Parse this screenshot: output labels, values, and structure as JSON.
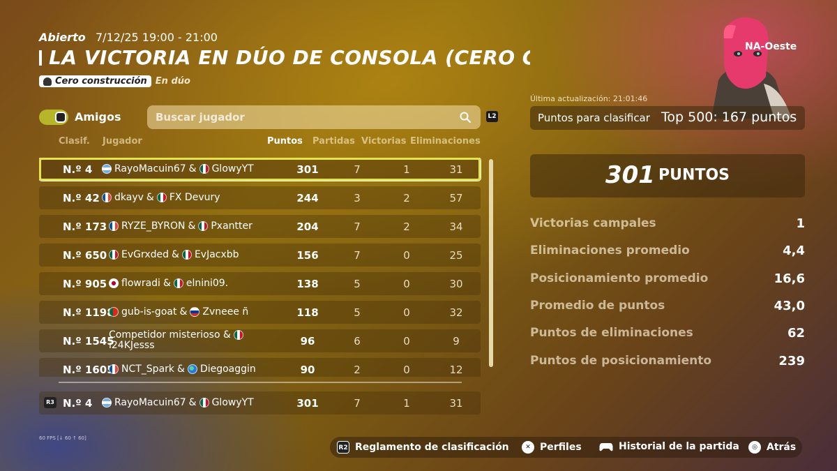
{
  "header": {
    "status": "Abierto",
    "datetime": "7/12/25 19:00 - 21:00",
    "title": "LA VICTORIA EN DÚO DE CONSOLA (CERO CONSTRUCCIÓN)",
    "mode_tag": "Cero construcción",
    "mode_sub": "En dúo"
  },
  "filters": {
    "friends_label": "Amigos",
    "friends_on": true,
    "search_placeholder": "Buscar jugador",
    "search_hotkey": "L2"
  },
  "columns": {
    "rank": "Clasif.",
    "player": "Jugador",
    "points": "Puntos",
    "matches": "Partidas",
    "wins": "Victorias",
    "elims": "Eliminaciones"
  },
  "rows": [
    {
      "rank": "N.º 4",
      "p1": "RayoMacuin67",
      "f1": "ar",
      "sep": "&",
      "p2": "GlowyYT",
      "f2": "mx",
      "points": "301",
      "matches": "7",
      "wins": "1",
      "elims": "31"
    },
    {
      "rank": "N.º 42",
      "p1": "dkayv",
      "f1": "fr",
      "sep": "&",
      "p2": "FX Devury",
      "f2": "mx",
      "points": "244",
      "matches": "3",
      "wins": "2",
      "elims": "57"
    },
    {
      "rank": "N.º 173",
      "p1": "RYZE_BYRON",
      "f1": "fr",
      "sep": "&",
      "p2": "Pxantter",
      "f2": "mx",
      "points": "204",
      "matches": "7",
      "wins": "2",
      "elims": "34"
    },
    {
      "rank": "N.º 650",
      "p1": "EvGrxded",
      "f1": "mx",
      "sep": "&",
      "p2": "EvJacxbb",
      "f2": "mx",
      "points": "156",
      "matches": "7",
      "wins": "0",
      "elims": "25"
    },
    {
      "rank": "N.º 905",
      "p1": "flowradi",
      "f1": "jp",
      "sep": "&",
      "p2": "elnini09.",
      "f2": "mx",
      "points": "138",
      "matches": "5",
      "wins": "0",
      "elims": "30"
    },
    {
      "rank": "N.º 1198",
      "p1": "gub-is-goat",
      "f1": "pt",
      "sep": "&",
      "p2": "Zvneee ñ",
      "f2": "ru",
      "points": "118",
      "matches": "5",
      "wins": "0",
      "elims": "32"
    },
    {
      "rank": "N.º 1545",
      "p1": "Competidor misterioso",
      "f1": "",
      "sep": "&",
      "p2": "i24KJesss",
      "f2": "mx",
      "points": "96",
      "matches": "6",
      "wins": "0",
      "elims": "9"
    },
    {
      "rank": "N.º 1605",
      "p1": "NCT_Spark",
      "f1": "fr",
      "sep": "&",
      "p2": "Diegoaggin",
      "f2": "globe",
      "points": "90",
      "matches": "2",
      "wins": "0",
      "elims": "12"
    }
  ],
  "me": {
    "rank": "N.º 4",
    "p1": "RayoMacuin67",
    "f1": "ar",
    "sep": "&",
    "p2": "GlowyYT",
    "f2": "mx",
    "points": "301",
    "matches": "7",
    "wins": "1",
    "elims": "31",
    "badge": "R3"
  },
  "panel": {
    "region": "NA-Oeste",
    "updated": "Última actualización: 21:01:46",
    "qualify_label": "Puntos para clasificar",
    "qualify_value": "Top 500: 167 puntos",
    "total_points": "301",
    "total_unit": "PUNTOS",
    "stats": [
      {
        "label": "Victorias campales",
        "value": "1"
      },
      {
        "label": "Eliminaciones promedio",
        "value": "4,4"
      },
      {
        "label": "Posicionamiento promedio",
        "value": "16,6"
      },
      {
        "label": "Promedio de puntos",
        "value": "43,0"
      },
      {
        "label": "Puntos de eliminaciones",
        "value": "62"
      },
      {
        "label": "Puntos de posicionamiento",
        "value": "239"
      }
    ]
  },
  "footer": {
    "fps": "60 FPS [↓ 60 ↑ 60]",
    "buttons": [
      {
        "key": "R2",
        "label": "Reglamento de clasificación"
      },
      {
        "key": "✕",
        "label": "Perfiles"
      },
      {
        "key": "gamepad",
        "label": "Historial de la partida"
      },
      {
        "key": "◎",
        "label": "Atrás"
      }
    ]
  },
  "colors": {
    "accent": "#e3e54a",
    "toggle": "#b7b62a"
  }
}
